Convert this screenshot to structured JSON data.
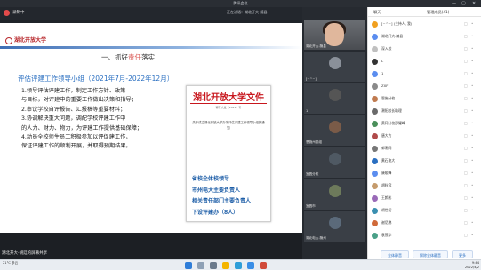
{
  "window": {
    "title": "腾讯会议",
    "minimize": "—",
    "maximize": "▢",
    "close": "✕"
  },
  "topbar": {
    "rec_label": "录制中",
    "speaking": "正在讲话：湖北开大-随县"
  },
  "slide": {
    "logo_text": "湖北开放大学",
    "heading_prefix": "一、抓好",
    "heading_highlight": "责任",
    "heading_suffix": "落实",
    "subtitle": "评估评建工作领导小组（2021年7月-2022年12月）",
    "items": [
      "1.领导评估评建工作，制定工作方针、政策",
      "与目标，对评建中的重要工作做出决策和指导；",
      "2.审议学校自评报告、汇报稿等重要材料；",
      "3.协调解决重大问题，调配学校评建工作中",
      "的人力、财力、物力，为评建工作提供基础保障；",
      "4.动员全校师生员工积极参加以评促建工作，",
      "保证评建工作的顺利开展，并取得预期结果。"
    ],
    "doc": {
      "title": "湖北开放大学文件",
      "number": "鄂开大发〔2021〕号",
      "subject": "关于成立湖北开放大学办学评估评建工作领导小组的通知",
      "list": [
        "省校全体校领导",
        "市州电大主要负责人",
        "相关责任部门主要负责人",
        "下设评建办（8人）"
      ]
    }
  },
  "videos": [
    {
      "label": "湖北开大-随县"
    },
    {
      "label": "[~^~]"
    },
    {
      "label": "1"
    },
    {
      "label": "恩施州委组"
    },
    {
      "label": "宜昌分校"
    },
    {
      "label": "宜昌市"
    },
    {
      "label": "湖北电大-随州"
    }
  ],
  "chat": {
    "tab_chat": "聊天",
    "tab_members": "管理成员(41)",
    "members": [
      {
        "name": "[~^~] (主持人, 我)",
        "color": "#f0a020"
      },
      {
        "name": "湖北开大-随县",
        "color": "#5b8def"
      },
      {
        "name": "深入校",
        "color": "#c0c0c0"
      },
      {
        "name": "L",
        "color": "#333333"
      },
      {
        "name": "1",
        "color": "#5b8def"
      },
      {
        "name": "ZXF",
        "color": "#8a8a8a"
      },
      {
        "name": "恩施分校",
        "color": "#c07b50"
      },
      {
        "name": "潮阳校长助理",
        "color": "#6a6a6a"
      },
      {
        "name": "黄冈分校邵耀峰",
        "color": "#4a8f5a"
      },
      {
        "name": "唐大力",
        "color": "#b04a4a"
      },
      {
        "name": "郭潮同",
        "color": "#777777"
      },
      {
        "name": "黄石电大",
        "color": "#2a6fc1"
      },
      {
        "name": "康顺锋",
        "color": "#5b8def"
      },
      {
        "name": "胡秋容",
        "color": "#c59b6c"
      },
      {
        "name": "王颜彬",
        "color": "#9a6ab8"
      },
      {
        "name": "胡世初",
        "color": "#3a8fb0"
      },
      {
        "name": "谢尼鹏",
        "color": "#d06a3a"
      },
      {
        "name": "袁茂华",
        "color": "#4aa088"
      }
    ],
    "btn_mute_all": "全体静音",
    "btn_unmute_all": "解除全体静音",
    "btn_more": "更多"
  },
  "bottom": {
    "nameplate": "湖北开大-胡廷的屏幕共享"
  },
  "taskbar": {
    "weather": "21°C 多云",
    "time": "9:44",
    "date": "2022/4/2"
  }
}
